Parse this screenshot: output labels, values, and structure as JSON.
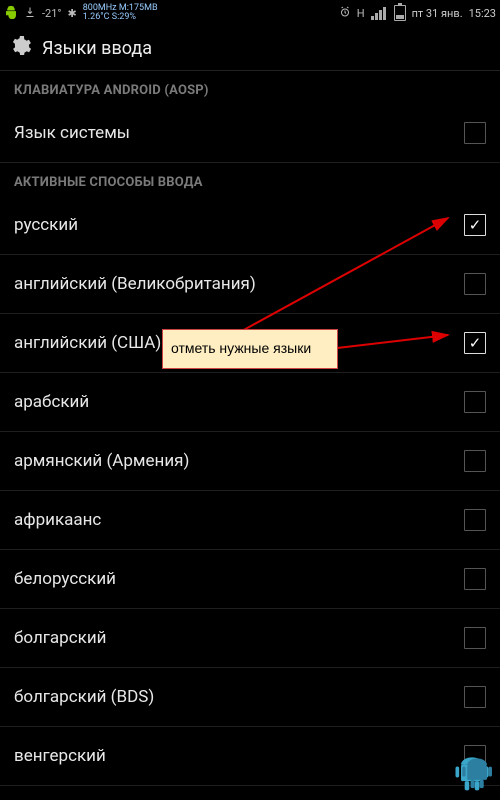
{
  "status": {
    "left": {
      "temp": "-21°",
      "cpu": "800MHz M:175MB",
      "cpu2": "1.26°C S:29%"
    },
    "right": {
      "net_label": "H",
      "date": "пт 31 янв.",
      "time": "15:23"
    }
  },
  "header": {
    "title": "Языки ввода"
  },
  "sections": {
    "keyboard": {
      "header": "КЛАВИАТУРА ANDROID (AOSP)",
      "system_language": "Язык системы"
    },
    "active": {
      "header": "АКТИВНЫЕ СПОСОБЫ ВВОДА",
      "items": [
        {
          "label": "русский",
          "checked": true
        },
        {
          "label": "английский (Великобритания)",
          "checked": false
        },
        {
          "label": "английский (США)",
          "checked": true
        },
        {
          "label": "арабский",
          "checked": false
        },
        {
          "label": "армянский (Армения)",
          "checked": false
        },
        {
          "label": "африкаанс",
          "checked": false
        },
        {
          "label": "белорусский",
          "checked": false
        },
        {
          "label": "болгарский",
          "checked": false
        },
        {
          "label": "болгарский (BDS)",
          "checked": false
        },
        {
          "label": "венгерский",
          "checked": false
        }
      ]
    }
  },
  "annotation": {
    "text": "отметь нужные языки"
  }
}
